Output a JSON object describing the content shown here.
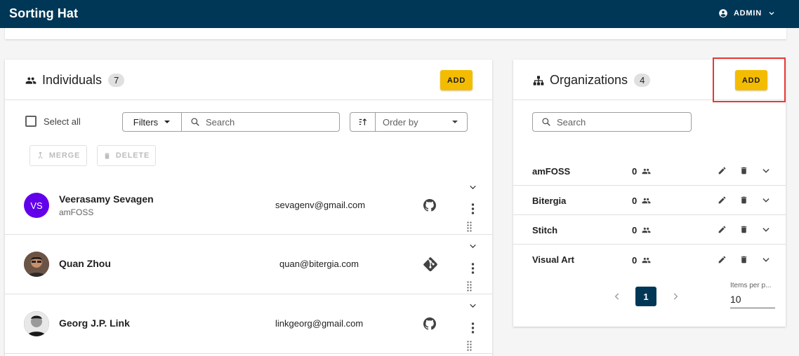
{
  "app": {
    "title": "Sorting Hat",
    "user_label": "ADMIN"
  },
  "individuals": {
    "title": "Individuals",
    "count": "7",
    "add_label": "ADD",
    "select_all_label": "Select all",
    "filters_label": "Filters",
    "search_placeholder": "Search",
    "order_by_placeholder": "Order by",
    "merge_label": "MERGE",
    "delete_label": "DELETE",
    "rows": [
      {
        "initials": "VS",
        "avatar_color": "#6200ea",
        "name": "Veerasamy Sevagen",
        "organization": "amFOSS",
        "email": "sevagenv@gmail.com",
        "source_icon": "github-icon"
      },
      {
        "name": "Quan Zhou",
        "email": "quan@bitergia.com",
        "source_icon": "git-icon"
      },
      {
        "name": "Georg J.P. Link",
        "email": "linkgeorg@gmail.com",
        "source_icon": "github-icon"
      }
    ]
  },
  "organizations": {
    "title": "Organizations",
    "count": "4",
    "add_label": "ADD",
    "search_placeholder": "Search",
    "items": [
      {
        "name": "amFOSS",
        "count": "0"
      },
      {
        "name": "Bitergia",
        "count": "0"
      },
      {
        "name": "Stitch",
        "count": "0"
      },
      {
        "name": "Visual Art",
        "count": "0"
      }
    ],
    "pagination": {
      "current_page": "1",
      "items_per_page_label": "Items per p...",
      "items_per_page": "10"
    }
  },
  "colors": {
    "header": "#003756",
    "accent": "#f4bc00",
    "highlight": "#e53935"
  }
}
